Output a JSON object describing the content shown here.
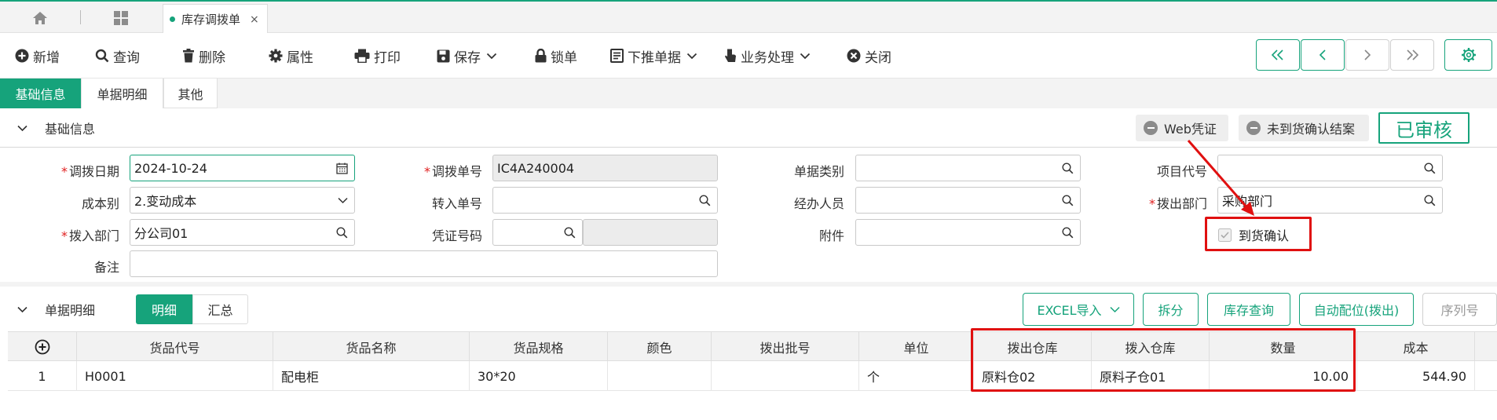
{
  "tabbar": {
    "active_tab": "库存调拨单",
    "close": "×"
  },
  "toolbar": {
    "items": [
      "新增",
      "查询",
      "删除",
      "属性",
      "打印",
      "保存",
      "锁单",
      "下推单据",
      "业务处理",
      "关闭"
    ]
  },
  "sections": {
    "tabs": [
      "基础信息",
      "单据明细",
      "其他"
    ],
    "basic_title": "基础信息",
    "detail_title": "单据明细"
  },
  "actions": {
    "web_voucher": "Web凭证",
    "unconfirm_close": "未到货确认结案",
    "status": "已审核"
  },
  "form": {
    "transfer_date": {
      "label": "调拨日期",
      "value": "2024-10-24"
    },
    "transfer_no": {
      "label": "调拨单号",
      "value": "IC4A240004"
    },
    "doc_type": {
      "label": "单据类别",
      "value": ""
    },
    "project_code": {
      "label": "项目代号",
      "value": ""
    },
    "cost_type": {
      "label": "成本别",
      "value": "2.变动成本"
    },
    "in_doc_no": {
      "label": "转入单号",
      "value": ""
    },
    "handler": {
      "label": "经办人员",
      "value": ""
    },
    "out_dept": {
      "label": "拨出部门",
      "value": "采购部门"
    },
    "in_dept": {
      "label": "拨入部门",
      "value": "分公司01"
    },
    "voucher_no": {
      "label": "凭证号码",
      "value": ""
    },
    "attachment": {
      "label": "附件",
      "value": ""
    },
    "arrival_confirm": {
      "label": "到货确认",
      "checked": true
    },
    "remark": {
      "label": "备注",
      "value": ""
    }
  },
  "detail": {
    "view_tabs": [
      "明细",
      "汇总"
    ],
    "buttons": {
      "excel": "EXCEL导入",
      "split": "拆分",
      "stock": "库存查询",
      "auto": "自动配位(拨出)",
      "serial": "序列号"
    },
    "columns": [
      "货品代号",
      "货品名称",
      "货品规格",
      "颜色",
      "拨出批号",
      "单位",
      "拨出仓库",
      "拨入仓库",
      "数量",
      "成本"
    ],
    "rows": [
      {
        "no": "1",
        "code": "H0001",
        "name": "配电柜",
        "spec": "30*20",
        "color": "",
        "batch": "",
        "unit": "个",
        "out_wh": "原料仓02",
        "in_wh": "原料子仓01",
        "qty": "10.00",
        "cost": "544.90"
      }
    ]
  },
  "colors": {
    "accent": "#16a37b",
    "highlight": "#e01010"
  }
}
